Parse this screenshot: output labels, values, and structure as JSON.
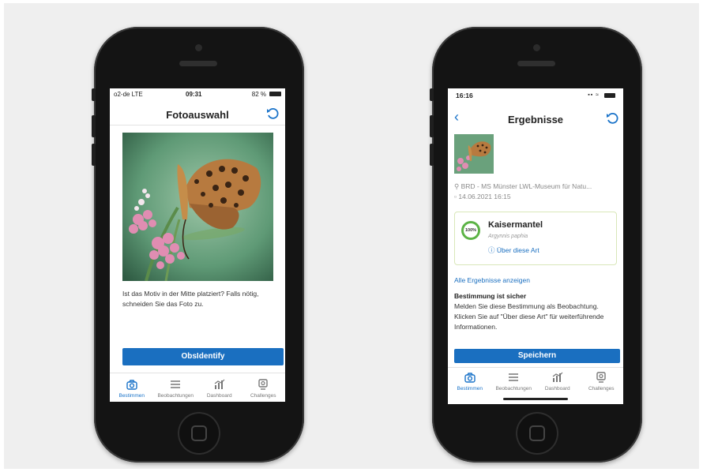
{
  "left_phone": {
    "status": {
      "carrier": "o2-de LTE",
      "time": "09:31",
      "battery": "82 %"
    },
    "title": "Fotoauswahl",
    "instruction": "Ist das Motiv in der Mitte platziert? Falls nötig, schneiden Sie das Foto zu.",
    "button": "ObsIdentify",
    "tabs": [
      "Bestimmen",
      "Beobachtungen",
      "Dashboard",
      "Challenges"
    ]
  },
  "right_phone": {
    "status": {
      "time": "16:16"
    },
    "title": "Ergebnisse",
    "location": "BRD - MS Münster LWL-Museum für Natu...",
    "date": "14.06.2021 16:15",
    "result": {
      "percent": "100%",
      "name": "Kaisermantel",
      "latin": "Argynnis paphia",
      "about_link": "Über diese Art"
    },
    "all_results": "Alle Ergebnisse anzeigen",
    "certain_heading": "Bestimmung ist sicher",
    "certain_text": "Melden Sie diese Bestimmung als Beobachtung. Klicken Sie auf \"Über diese Art\" für weiterführende Informationen.",
    "save_button": "Speichern",
    "tabs": [
      "Bestimmen",
      "Beobachtungen",
      "Dashboard",
      "Challenges"
    ]
  },
  "colors": {
    "accent": "#1a6fc0",
    "confidence": "#5cb346",
    "panel": "#efefef"
  }
}
